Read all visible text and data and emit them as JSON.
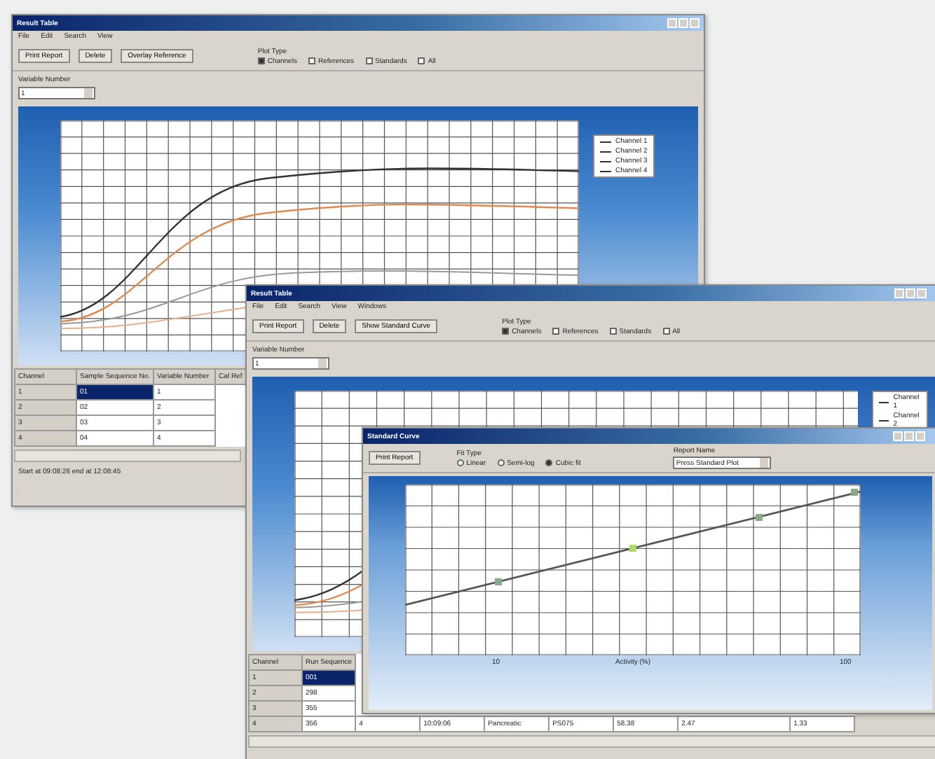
{
  "result_window": {
    "title": "Result Table",
    "menu": [
      "File",
      "Edit",
      "Search",
      "View"
    ],
    "toolbar": [
      "Print Report",
      "Delete",
      "Overlay Reference"
    ],
    "plot_type": {
      "label": "Plot Type",
      "options": [
        {
          "label": "Channels",
          "checked": true
        },
        {
          "label": "References",
          "checked": false
        },
        {
          "label": "Standards",
          "checked": false
        },
        {
          "label": "All",
          "checked": false
        }
      ]
    },
    "variable": {
      "label": "Variable Number",
      "value": "1"
    },
    "legend": [
      "Channel 1",
      "Channel 2",
      "Channel 3",
      "Channel 4"
    ],
    "table": {
      "columns": [
        "Channel",
        "Sample Sequence No.",
        "Variable Number",
        "Cal Ref"
      ],
      "rows": [
        {
          "cells": [
            "1",
            "01",
            "1"
          ],
          "selected": true
        },
        {
          "cells": [
            "2",
            "02",
            "2"
          ],
          "selected": false
        },
        {
          "cells": [
            "3",
            "03",
            "3"
          ],
          "selected": false
        },
        {
          "cells": [
            "4",
            "04",
            "4"
          ],
          "selected": false
        }
      ]
    },
    "status": "Start at 09:08:26 end at 12:08:45"
  },
  "curve_window": {
    "title": "Result Table",
    "menu": [
      "File",
      "Edit",
      "Search",
      "View",
      "Windows"
    ],
    "toolbar": [
      "Print Report",
      "Delete",
      "Show Standard Curve"
    ],
    "plot_type": {
      "label": "Plot Type",
      "options": [
        {
          "label": "Channels",
          "checked": true
        },
        {
          "label": "References",
          "checked": false
        },
        {
          "label": "Standards",
          "checked": false
        },
        {
          "label": "All",
          "checked": false
        }
      ]
    },
    "variable": {
      "label": "Variable Number",
      "value": "1"
    },
    "legend": [
      "Channel 1",
      "Channel 2"
    ],
    "table": {
      "columns": [
        "Channel",
        "Run Sequence"
      ],
      "rows": [
        {
          "cells": [
            "1",
            "001"
          ],
          "selected": true
        },
        {
          "cells": [
            "2",
            "298"
          ],
          "selected": false
        },
        {
          "cells": [
            "3",
            "355"
          ],
          "selected": false
        },
        {
          "cells": [
            "4",
            "356",
            "4",
            "10:09:06",
            "Pancreatic",
            "PS075",
            "58.38",
            "2.47",
            "1.33"
          ],
          "selected": false
        }
      ]
    }
  },
  "standard_curve_dialog": {
    "title": "Standard Curve",
    "toolbar": [
      "Print Report"
    ],
    "fit_type": {
      "label": "Fit Type",
      "options": [
        {
          "label": "Linear",
          "selected": false
        },
        {
          "label": "Semi-log",
          "selected": false
        },
        {
          "label": "Cubic fit",
          "selected": true
        }
      ]
    },
    "report": {
      "label": "Report Name",
      "value": "Press Standard Plot"
    },
    "x_ticks": [
      "10",
      "100"
    ],
    "xlabel": "Activity (%)"
  }
}
